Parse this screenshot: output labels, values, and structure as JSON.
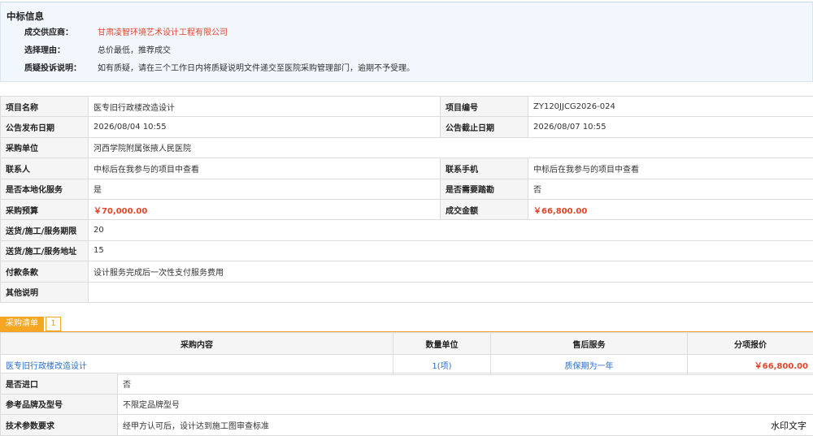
{
  "winner": {
    "title": "中标信息",
    "rows": [
      {
        "label": "成交供应商：",
        "value": "甘肃凌智环境艺术设计工程有限公司"
      },
      {
        "label": "选择理由：",
        "value": "总价最低，推荐成交"
      },
      {
        "label": "质疑投诉说明：",
        "value": "如有质疑，请在三个工作日内将质疑说明文件递交至医院采购管理部门，逾期不予受理。"
      }
    ]
  },
  "info": {
    "project_name_label": "项目名称",
    "project_name": "医专旧行政楼改造设计",
    "project_no_label": "项目编号",
    "project_no": "ZY120JJCG2026-024",
    "publish_date_label": "公告发布日期",
    "publish_date": "2026/08/04 10:55",
    "deadline_label": "公告截止日期",
    "deadline": "2026/08/07 10:55",
    "purchaser_label": "采购单位",
    "purchaser": "河西学院附属张掖人民医院",
    "contact_label": "联系人",
    "contact": "中标后在我参与的项目中查看",
    "phone_label": "联系手机",
    "phone": "中标后在我参与的项目中查看",
    "local_label": "是否本地化服务",
    "local": "是",
    "site_visit_label": "是否需要踏勘",
    "site_visit": "否",
    "budget_label": "采购预算",
    "budget": "￥70,000.00",
    "deal_amount_label": "成交金额",
    "deal_amount": "￥66,800.00",
    "period_label": "送货/施工/服务期限",
    "period": "20",
    "address_label": "送货/施工/服务地址",
    "address": "15",
    "payment_label": "付款条款",
    "payment": "设计服务完成后一次性支付服务费用",
    "other_label": "其他说明",
    "other": ""
  },
  "purchase_list": {
    "tab_label": "采购清单",
    "count": "1",
    "headers": [
      "采购内容",
      "数量单位",
      "售后服务",
      "分项报价"
    ],
    "rows": [
      {
        "content": "医专旧行政楼改造设计",
        "qty": "1(项)",
        "service": "质保期为一年",
        "price": "￥66,800.00"
      }
    ]
  },
  "detail": {
    "import_label": "是否进口",
    "import": "否",
    "brand_label": "参考品牌及型号",
    "brand": "不限定品牌型号",
    "tech_label": "技术参数要求",
    "tech": "经甲方认可后，设计达到施工图审查标准"
  },
  "watermark": "水印文字",
  "colors": {
    "accent_red": "#e2452a",
    "link_blue": "#2a6fc9",
    "tab_orange": "#f5a623"
  }
}
